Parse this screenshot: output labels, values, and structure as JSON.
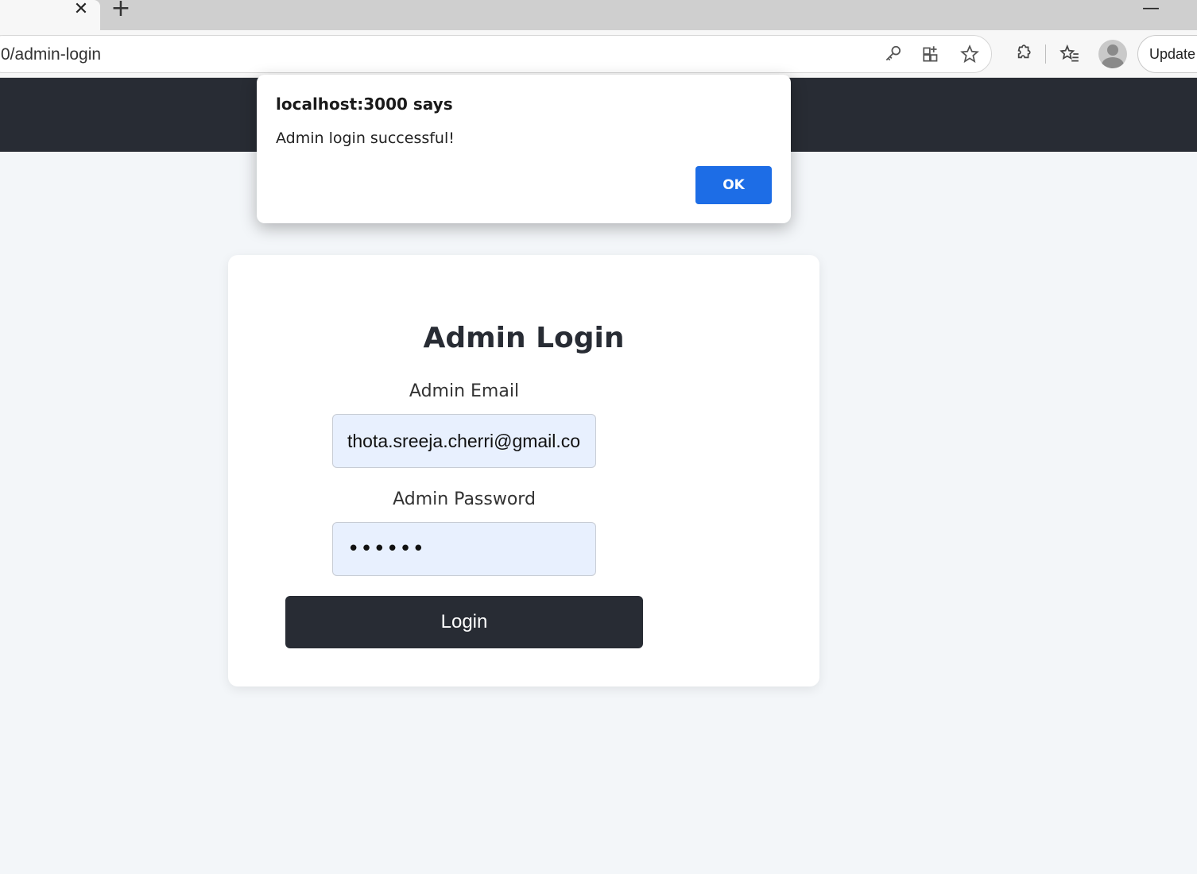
{
  "browser": {
    "tab_close_glyph": "✕",
    "new_tab_glyph": "+",
    "minimize_glyph": "—",
    "address": "0/admin-login",
    "update_label": "Update",
    "icons": [
      "key-icon",
      "apps-icon",
      "star-icon",
      "extensions-icon",
      "favorites-icon",
      "profile-avatar"
    ]
  },
  "page": {
    "title": "Admin Login",
    "email_label": "Admin Email",
    "email_value": "thota.sreeja.cherri@gmail.com",
    "password_label": "Admin Password",
    "password_value": "123456",
    "login_label": "Login"
  },
  "dialog": {
    "title": "localhost:3000 says",
    "message": "Admin login successful!",
    "ok_label": "OK"
  },
  "colors": {
    "navbar": "#282c34",
    "background": "#f3f6f9",
    "input_fill": "#e8f0fe",
    "ok_button": "#1d6de6"
  }
}
